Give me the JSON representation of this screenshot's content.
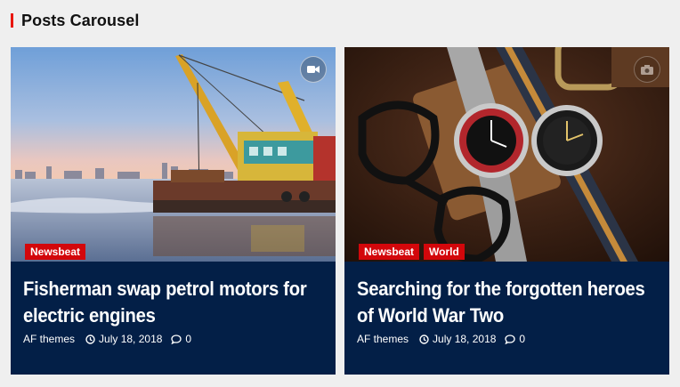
{
  "section": {
    "title": "Posts Carousel"
  },
  "posts": [
    {
      "categories": [
        "Newsbeat"
      ],
      "title": "Fisherman swap petrol motors for electric engines",
      "author": "AF themes",
      "date": "July 18, 2018",
      "comments": "0",
      "format_icon": "video-camera-icon"
    },
    {
      "categories": [
        "Newsbeat",
        "World"
      ],
      "title": "Searching for the forgotten heroes of World War Two",
      "author": "AF themes",
      "date": "July 18, 2018",
      "comments": "0",
      "format_icon": "camera-icon"
    }
  ],
  "colors": {
    "accent": "#e8170e",
    "category_bg": "#d3070b",
    "card_bg": "#031f47",
    "page_bg": "#efefef"
  }
}
